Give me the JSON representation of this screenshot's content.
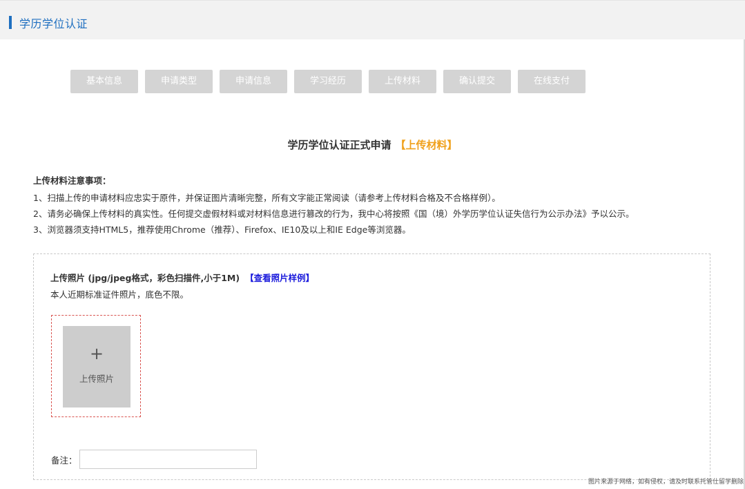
{
  "header": {
    "title": "学历学位认证"
  },
  "steps": [
    "基本信息",
    "申请类型",
    "申请信息",
    "学习经历",
    "上传材料",
    "确认提交",
    "在线支付"
  ],
  "form": {
    "title": "学历学位认证正式申请",
    "current_step": "【上传材料】"
  },
  "notes": {
    "title": "上传材料注意事项：",
    "lines": [
      "1、扫描上传的申请材料应忠实于原件，并保证图片清晰完整，所有文字能正常阅读（请参考上传材料合格及不合格样例）。",
      "2、请务必确保上传材料的真实性。任何提交虚假材料或对材料信息进行篡改的行为，我中心将按照《国（境）外学历学位认证失信行为公示办法》予以公示。",
      "3、浏览器须支持HTML5，推荐使用Chrome（推荐）、Firefox、IE10及以上和IE Edge等浏览器。"
    ]
  },
  "upload": {
    "label": "上传照片 (jpg/jpeg格式，彩色扫描件,小于1M)",
    "sample_link": "【查看照片样例】",
    "description": "本人近期标准证件照片，底色不限。",
    "button_plus": "+",
    "button_text": "上传照片"
  },
  "remark": {
    "label": "备注：",
    "value": ""
  },
  "watermark": "图片来源于网络，如有侵权，请及时联系托管仕留学删除",
  "colors": {
    "header_accent": "#1e6fc0",
    "step_bg": "#d4d4d4",
    "step_highlight": "#f0a11c",
    "link": "#1a1adc",
    "photo_border": "#d9534f"
  }
}
